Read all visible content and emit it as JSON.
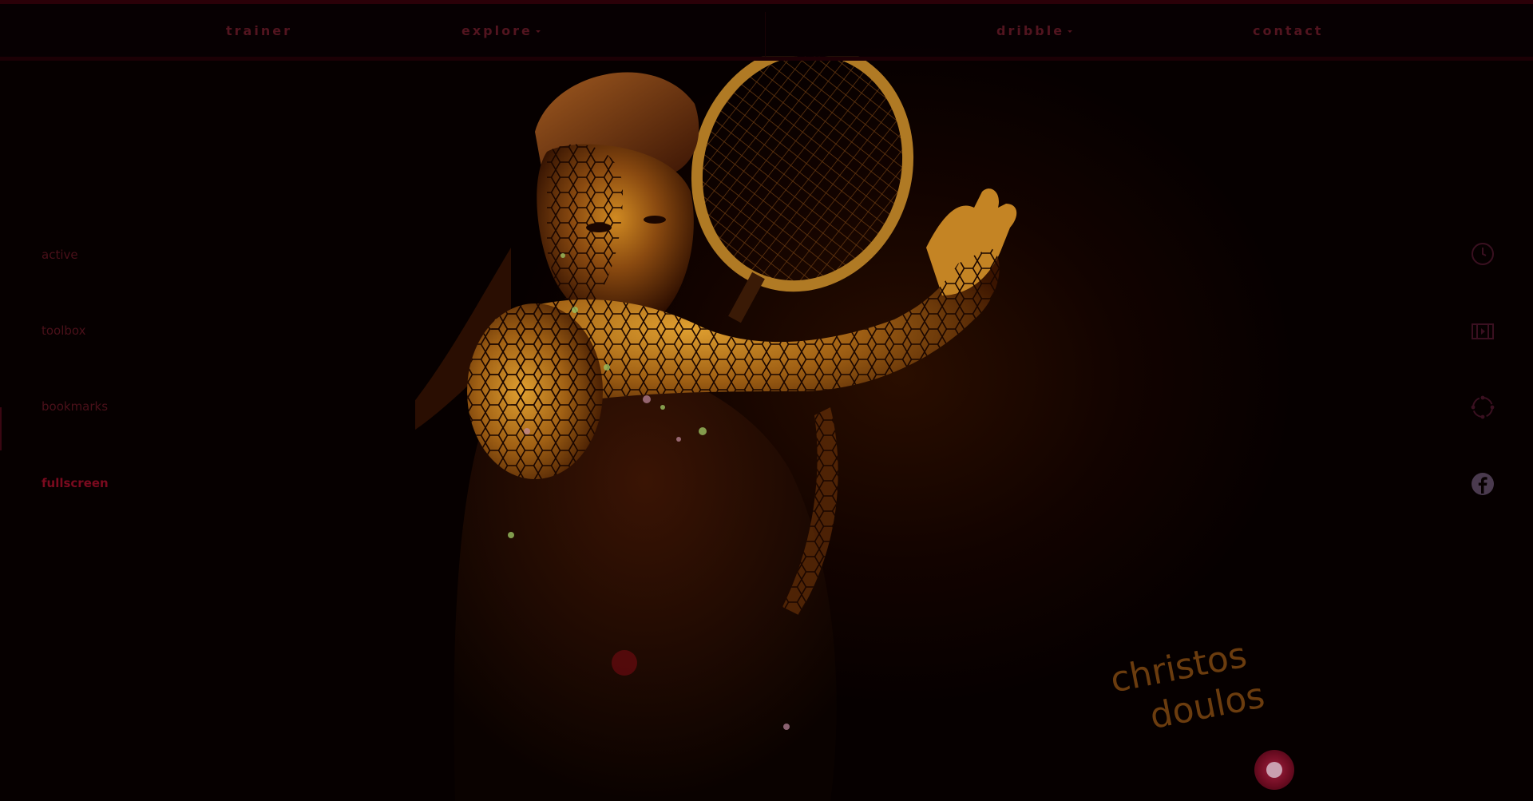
{
  "nav": {
    "items": [
      {
        "label": "trainer",
        "has_dropdown": false
      },
      {
        "label": "explore",
        "has_dropdown": true
      },
      {
        "label": "dribble",
        "has_dropdown": true
      },
      {
        "label": "contact",
        "has_dropdown": false
      }
    ]
  },
  "side_menu": {
    "items": [
      {
        "label": "active"
      },
      {
        "label": "toolbox"
      },
      {
        "label": "bookmarks"
      },
      {
        "label": "fullscreen"
      }
    ]
  },
  "right_icons": [
    "clock-icon",
    "film-icon",
    "refresh-circle-icon",
    "facebook-icon"
  ],
  "signature": {
    "line1": "christos",
    "line2": "doulos"
  },
  "colors": {
    "background": "#050000",
    "nav_text": "#52141f",
    "side_text": "#4a1019",
    "accent": "#7a0a1e",
    "signature": "#6b3c0e",
    "icon": "#3a1020"
  }
}
